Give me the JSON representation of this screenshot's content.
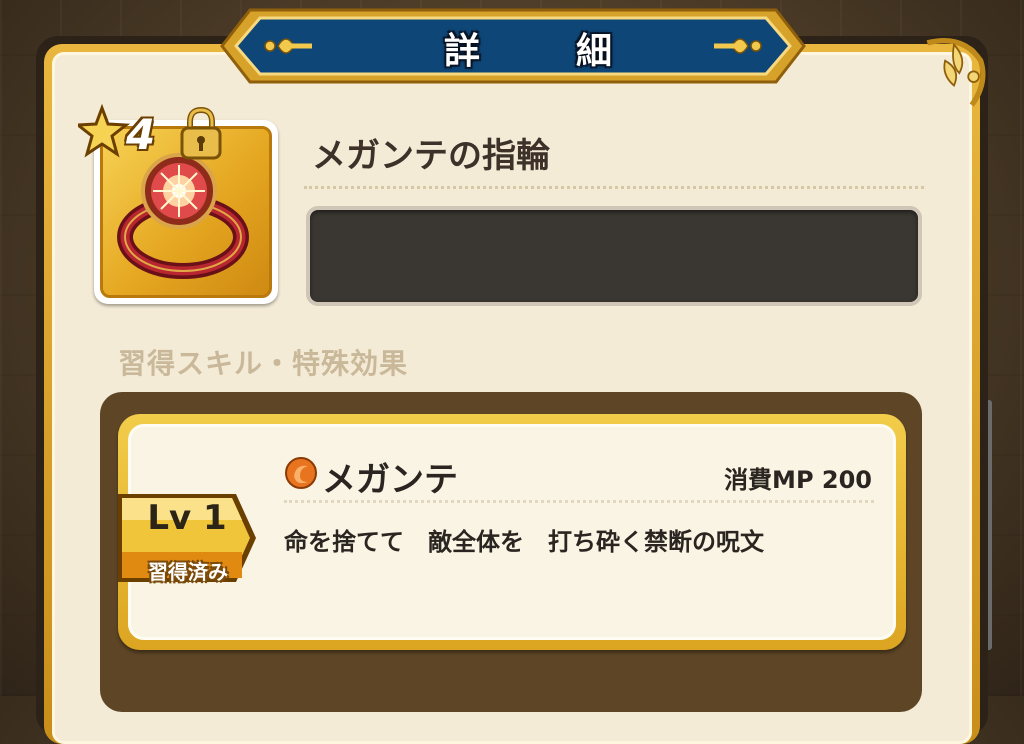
{
  "header": {
    "title": "詳　細"
  },
  "item": {
    "rarity": "4",
    "name": "メガンテの指輪",
    "icon": "ring-icon",
    "locked": true
  },
  "section": {
    "label": "習得スキル・特殊効果"
  },
  "skill": {
    "level": "Lv 1",
    "status": "習得済み",
    "name": "メガンテ",
    "mp_cost": "消費MP 200",
    "description": "命を捨てて　敵全体を　打ち砕く禁断の呪文"
  },
  "colors": {
    "banner": "#0f4a7c",
    "gold": "#e2ad2d",
    "panel": "#f4ebd6",
    "skill_orb": "#e8741f"
  }
}
